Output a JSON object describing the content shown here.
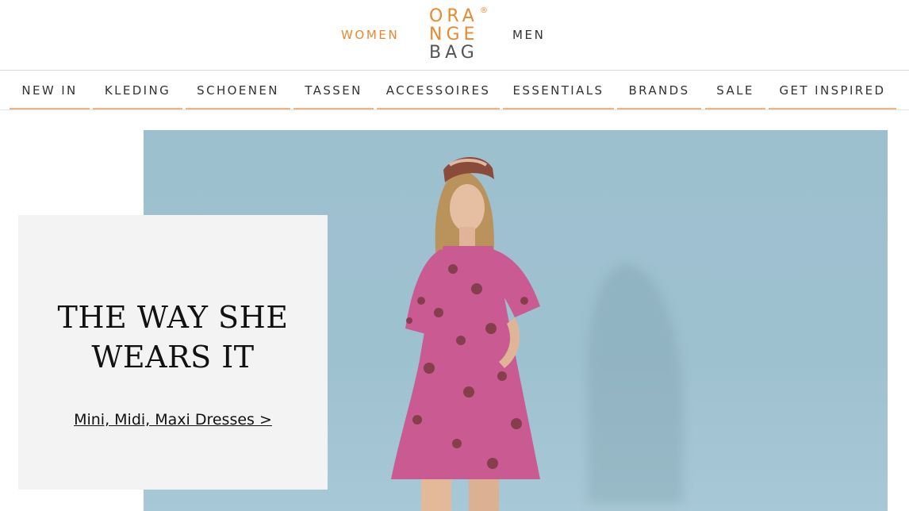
{
  "header": {
    "women_label": "WOMEN",
    "men_label": "MEN",
    "logo": {
      "line1": "ORA",
      "line2": "NGE",
      "line3": "BAG",
      "registered": "®"
    }
  },
  "nav": {
    "items": [
      {
        "label": "NEW IN"
      },
      {
        "label": "KLEDING"
      },
      {
        "label": "SCHOENEN"
      },
      {
        "label": "TASSEN"
      },
      {
        "label": "ACCESSOIRES"
      },
      {
        "label": "ESSENTIALS"
      },
      {
        "label": "BRANDS"
      },
      {
        "label": "SALE"
      },
      {
        "label": "GET INSPIRED"
      }
    ]
  },
  "hero": {
    "title": "THE WAY SHE WEARS IT",
    "link": "Mini, Midi, Maxi Dresses >"
  },
  "colors": {
    "accent": "#e8892f",
    "nav_underline": "#f2b27c",
    "hero_background": "#9dc0cf",
    "promo_background": "#f4f3f3",
    "dress": "#c95a92"
  }
}
